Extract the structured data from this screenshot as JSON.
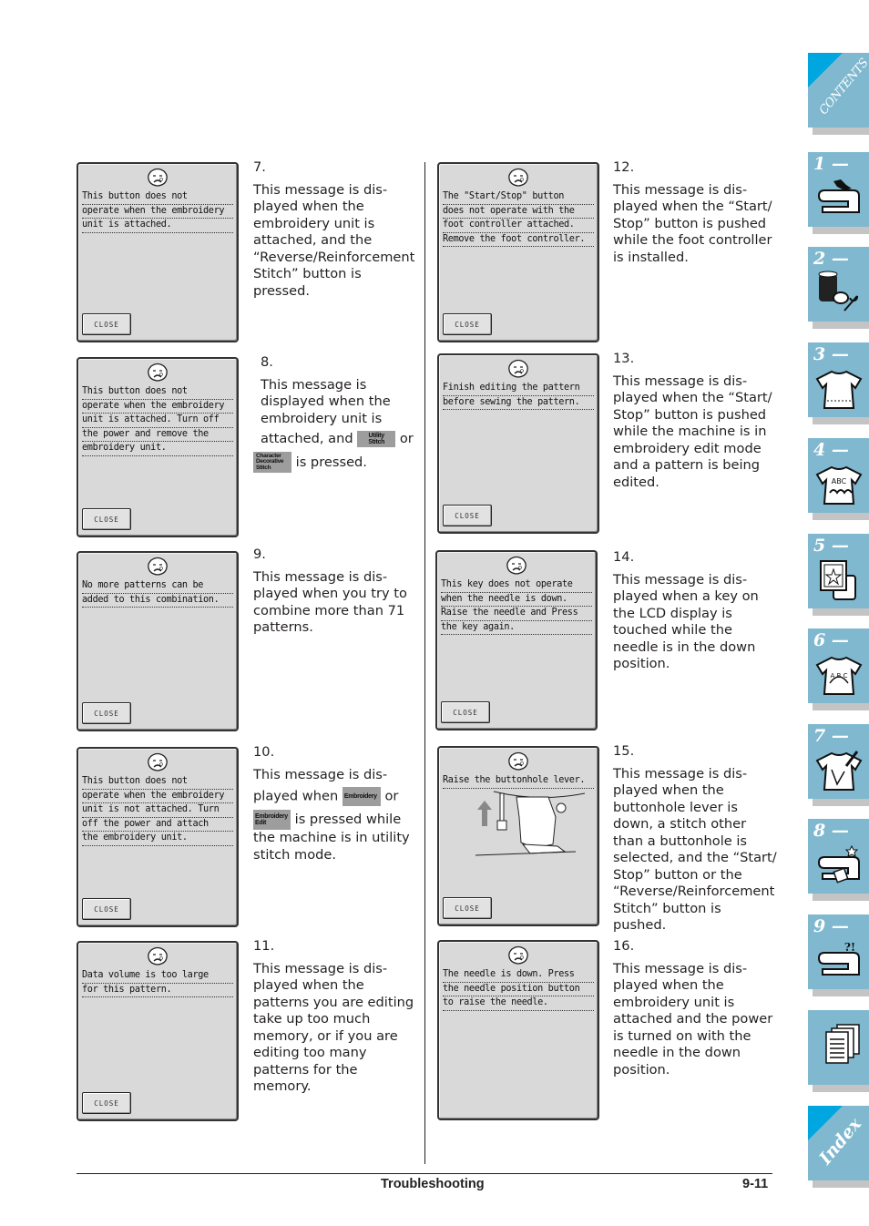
{
  "messages": [
    {
      "num": "7.",
      "lines": [
        "This button does not",
        "operate when the embroidery",
        "unit is attached."
      ],
      "close": "CLOSE",
      "desc": [
        "This message is dis-",
        "played when the",
        "embroidery unit is",
        "attached, and the",
        "“Reverse/Reinforcement",
        "Stitch” button is",
        "pressed."
      ]
    },
    {
      "num": "8.",
      "lines": [
        "This button does not",
        "operate when the embroidery",
        "unit is attached. Turn off",
        "the power and remove the",
        "embroidery unit."
      ],
      "close": "CLOSE",
      "desc_a": [
        "This message is",
        "displayed when the",
        "embroidery unit is"
      ],
      "desc_attached": "attached, and",
      "desc_or": "or",
      "desc_pressed": "is pressed.",
      "key1": [
        "Utility",
        "Stitch"
      ],
      "key2": [
        "Character",
        "Decorative",
        "Stitch"
      ]
    },
    {
      "num": "9.",
      "lines": [
        "No more patterns can be",
        "added to this combination."
      ],
      "close": "CLOSE",
      "desc": [
        "This message is dis-",
        "played when you try to",
        "combine more than 71",
        "patterns."
      ]
    },
    {
      "num": "10.",
      "lines": [
        "This button does not",
        "operate when the embroidery",
        "unit is not attached. Turn",
        "off the power and attach",
        "the embroidery unit."
      ],
      "close": "CLOSE",
      "desc_a": "This message is dis-",
      "desc_when": "played when",
      "desc_or": "or",
      "desc_pressed": "is pressed while",
      "desc_b": [
        "the machine is in utility",
        "stitch mode."
      ],
      "key1": [
        "Embroidery"
      ],
      "key2": [
        "Embroidery",
        "Edit"
      ]
    },
    {
      "num": "11.",
      "lines": [
        "Data volume is too large",
        "for this pattern."
      ],
      "close": "CLOSE",
      "desc": [
        "This message is dis-",
        "played when the",
        "patterns you are editing",
        "take up too much",
        "memory, or if you are",
        "editing too many",
        "patterns for the memory."
      ]
    },
    {
      "num": "12.",
      "lines": [
        "The \"Start/Stop\" button",
        "does not operate with the",
        "foot controller attached.",
        "Remove the foot controller."
      ],
      "close": "CLOSE",
      "desc": [
        "This message is dis-",
        "played when the “Start/",
        "Stop” button is pushed",
        "while the foot controller",
        "is installed."
      ]
    },
    {
      "num": "13.",
      "lines": [
        "Finish editing the pattern",
        "before sewing the pattern."
      ],
      "close": "CLOSE",
      "desc": [
        "This message is dis-",
        "played when the “Start/",
        "Stop” button is pushed",
        "while the machine is in",
        "embroidery edit mode",
        "and a pattern is being",
        "edited."
      ]
    },
    {
      "num": "14.",
      "lines": [
        "This key does not operate",
        "when the needle is down.",
        "Raise the needle and Press",
        "the key again."
      ],
      "close": "CLOSE",
      "desc": [
        "This message is dis-",
        "played when a key on",
        "the LCD display is",
        "touched while the",
        "needle is in the down",
        "position."
      ]
    },
    {
      "num": "15.",
      "lines": [
        "Raise the buttonhole lever."
      ],
      "close": "CLOSE",
      "desc": [
        "This message is dis-",
        "played when the",
        "buttonhole lever is",
        "down, a stitch other",
        "than a buttonhole is",
        "selected, and the “Start/",
        "Stop” button or the",
        "“Reverse/Reinforcement",
        "Stitch” button is pushed."
      ]
    },
    {
      "num": "16.",
      "lines": [
        "The needle is down. Press",
        "the needle position button",
        "to raise the needle."
      ],
      "close": "CLOSE",
      "desc": [
        "This message is dis-",
        "played when the",
        "embroidery unit is",
        "attached and the power",
        "is turned on with the",
        "needle in the down",
        "position."
      ]
    }
  ],
  "footer": {
    "title": "Troubleshooting",
    "page": "9-11"
  },
  "tabs": {
    "contents": "CONTENTS",
    "chapters": [
      "1 —",
      "2 —",
      "3 —",
      "4 —",
      "5 —",
      "6 —",
      "7 —",
      "8 —",
      "9 —"
    ],
    "index": "Index",
    "colors": {
      "tab": "#7fb8cf",
      "corner": "#00a6e0"
    }
  }
}
